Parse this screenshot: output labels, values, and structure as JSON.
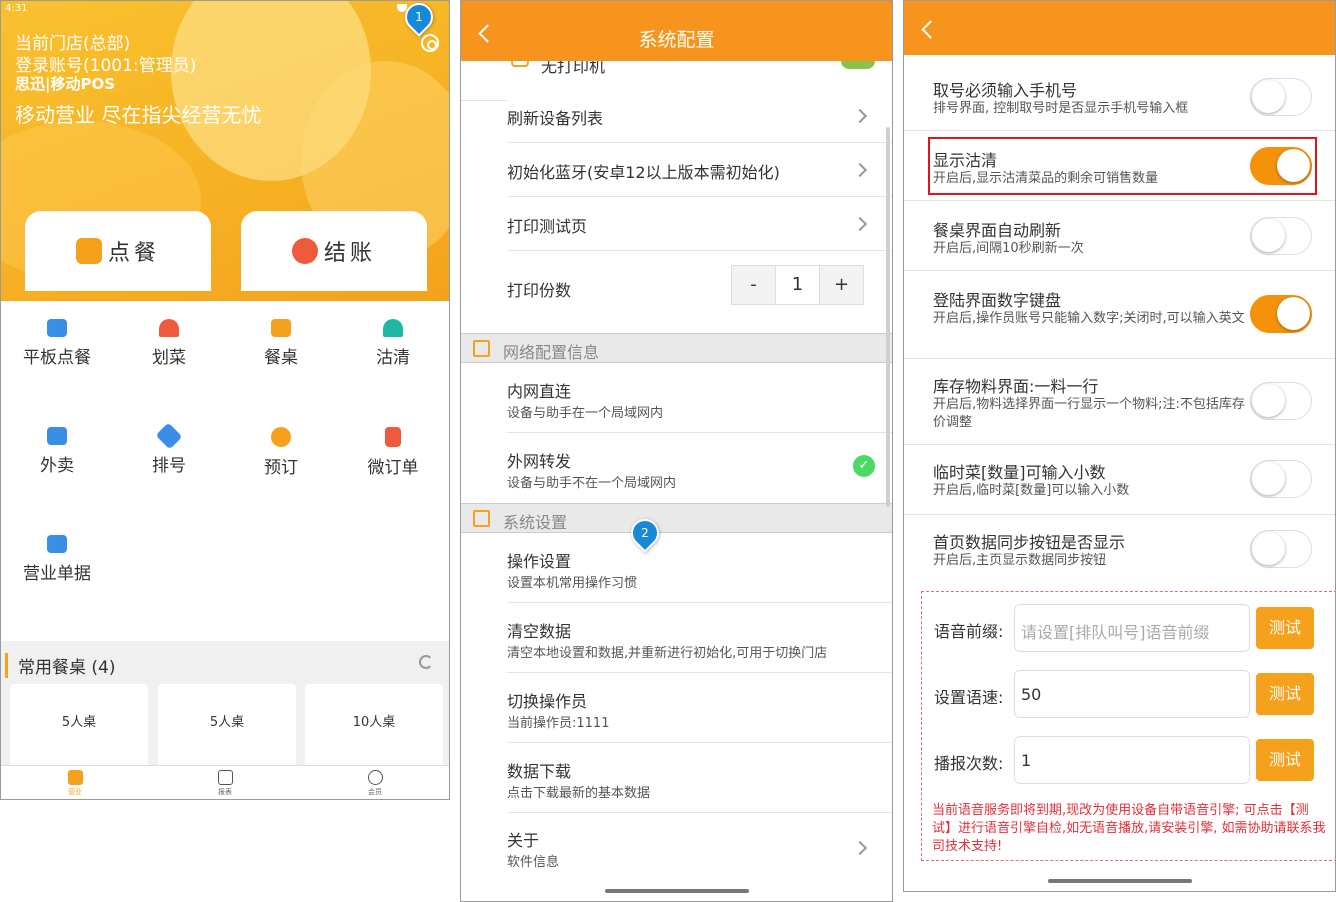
{
  "panel1": {
    "status_time": "4:31",
    "store": "当前门店(总部)",
    "account": "登录账号(1001:管理员)",
    "brand": "思迅|移动POS",
    "slogan": "移动营业 尽在指尖经营无忧",
    "pin1": "1",
    "tab_order": "点餐",
    "tab_checkout": "结账",
    "grid_items": [
      {
        "label": "平板点餐",
        "icon": "tablet-order-icon",
        "color": "#3a8ee6"
      },
      {
        "label": "划菜",
        "icon": "cloche-icon",
        "color": "#f05a3c"
      },
      {
        "label": "餐桌",
        "icon": "table-icon",
        "color": "#f5a11c"
      },
      {
        "label": "沽清",
        "icon": "sold-out-icon",
        "color": "#1db7a5"
      },
      {
        "label": "外卖",
        "icon": "delivery-icon",
        "color": "#3a8ee6"
      },
      {
        "label": "排号",
        "icon": "queue-tag-icon",
        "color": "#3a8ee6"
      },
      {
        "label": "预订",
        "icon": "clock-icon",
        "color": "#f5a11c"
      },
      {
        "label": "微订单",
        "icon": "document-icon",
        "color": "#f05a3c"
      },
      {
        "label": "营业单据",
        "icon": "chart-icon",
        "color": "#3a8ee6"
      }
    ],
    "frequent_title": "常用餐桌 (4)",
    "tables": [
      "5人桌",
      "5人桌",
      "10人桌"
    ],
    "nav": [
      "营业",
      "报表",
      "会员"
    ],
    "accent": "#f5a11c"
  },
  "panel2": {
    "title": "系统配置",
    "pin2": "2",
    "partial_label": "无打印机",
    "rows_top": [
      "刷新设备列表",
      "初始化蓝牙(安卓12以上版本需初始化)",
      "打印测试页"
    ],
    "print_copies_label": "打印份数",
    "stepper": {
      "minus": "-",
      "value": "1",
      "plus": "+"
    },
    "section_network": "网络配置信息",
    "network": [
      {
        "title": "内网直连",
        "sub": "设备与助手在一个局域网内"
      },
      {
        "title": "外网转发",
        "sub": "设备与助手不在一个局域网内",
        "check": "✓"
      }
    ],
    "section_system": "系统设置",
    "system": [
      {
        "title": "操作设置",
        "sub": "设置本机常用操作习惯"
      },
      {
        "title": "清空数据",
        "sub": "清空本地设置和数据,并重新进行初始化,可用于切换门店"
      },
      {
        "title": "切换操作员",
        "sub": "当前操作员:1111"
      },
      {
        "title": "数据下载",
        "sub": "点击下载最新的基本数据"
      },
      {
        "title": "关于",
        "sub": "软件信息"
      }
    ]
  },
  "panel3": {
    "settings": [
      {
        "title": "取号必须输入手机号",
        "sub": "排号界面, 控制取号时是否显示手机号输入框",
        "on": false
      },
      {
        "title": "显示沽清",
        "sub": "开启后,显示沽清菜品的剩余可销售数量",
        "on": true
      },
      {
        "title": "餐桌界面自动刷新",
        "sub": "开启后,间隔10秒刷新一次",
        "on": false
      },
      {
        "title": "登陆界面数字键盘",
        "sub": "开启后,操作员账号只能输入数字;关闭时,可以输入英文",
        "on": true
      },
      {
        "title": "库存物料界面:一料一行",
        "sub": "开启后,物料选择界面一行显示一个物料;注:不包括库存价调整",
        "on": false
      },
      {
        "title": "临时菜[数量]可输入小数",
        "sub": "开启后,临时菜[数量]可以输入小数",
        "on": false
      },
      {
        "title": "首页数据同步按钮是否显示",
        "sub": "开启后,主页显示数据同步按钮",
        "on": false
      }
    ],
    "voice": {
      "prefix_label": "语音前缀:",
      "prefix_placeholder": "请设置[排队叫号]语音前缀",
      "speed_label": "设置语速:",
      "speed_value": "50",
      "count_label": "播报次数:",
      "count_value": "1",
      "test_label": "测试",
      "notice": "当前语音服务即将到期,现改为使用设备自带语音引擎; 可点击【测试】进行语音引擎自检,如无语音播放,请安装引擎, 如需协助请联系我司技术支持!"
    },
    "toggle_on_color": "#f5920b",
    "highlight_color": "#e0141e"
  }
}
